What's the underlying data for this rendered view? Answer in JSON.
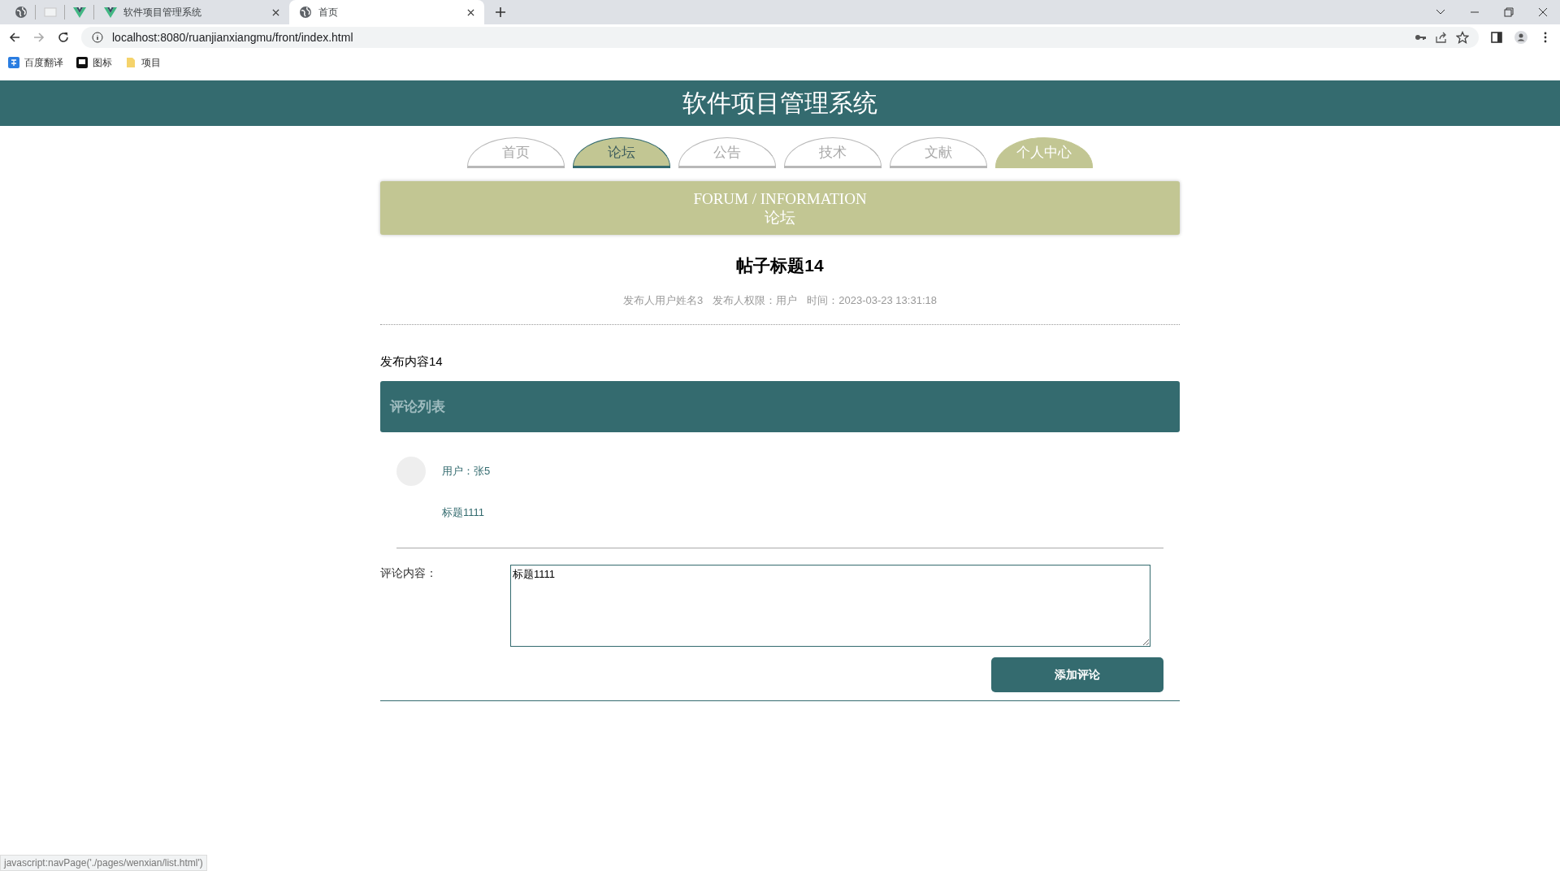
{
  "browser": {
    "tabs": [
      {
        "kind": "globe",
        "selected": false
      },
      {
        "kind": "page",
        "selected": false
      },
      {
        "kind": "logo",
        "selected": false
      },
      {
        "kind": "logo",
        "title": "软件项目管理系统",
        "selected": false
      },
      {
        "kind": "globe",
        "title": "首页",
        "selected": true
      }
    ],
    "address": "localhost:8080/ruanjianxiangmu/front/index.html",
    "bookmarks": [
      {
        "kind": "translate",
        "label": "百度翻译"
      },
      {
        "kind": "flag",
        "label": "图标"
      },
      {
        "kind": "folder",
        "label": "项目"
      }
    ],
    "status_text": "javascript:navPage('./pages/wenxian/list.html')"
  },
  "header": {
    "title": "软件项目管理系统"
  },
  "nav": [
    {
      "label": "首页",
      "selected": false,
      "hovered": false
    },
    {
      "label": "论坛",
      "selected": true,
      "hovered": false
    },
    {
      "label": "公告",
      "selected": false,
      "hovered": false
    },
    {
      "label": "技术",
      "selected": false,
      "hovered": false
    },
    {
      "label": "文献",
      "selected": false,
      "hovered": false
    },
    {
      "label": "个人中心",
      "selected": false,
      "hovered": true
    }
  ],
  "banner": {
    "title": "FORUM / INFORMATION",
    "subtitle": "论坛"
  },
  "post": {
    "title": "帖子标题14",
    "meta": [
      "发布人用户姓名3",
      "发布人权限：用户",
      "时间：2023-03-23 13:31:18"
    ],
    "content": "发布内容14"
  },
  "comments": {
    "header": "评论列表",
    "items": [
      {
        "user": "用户：张5",
        "content": "标题1111"
      }
    ]
  },
  "form": {
    "label": "评论内容：",
    "value": "标题1111",
    "button": "添加评论"
  }
}
